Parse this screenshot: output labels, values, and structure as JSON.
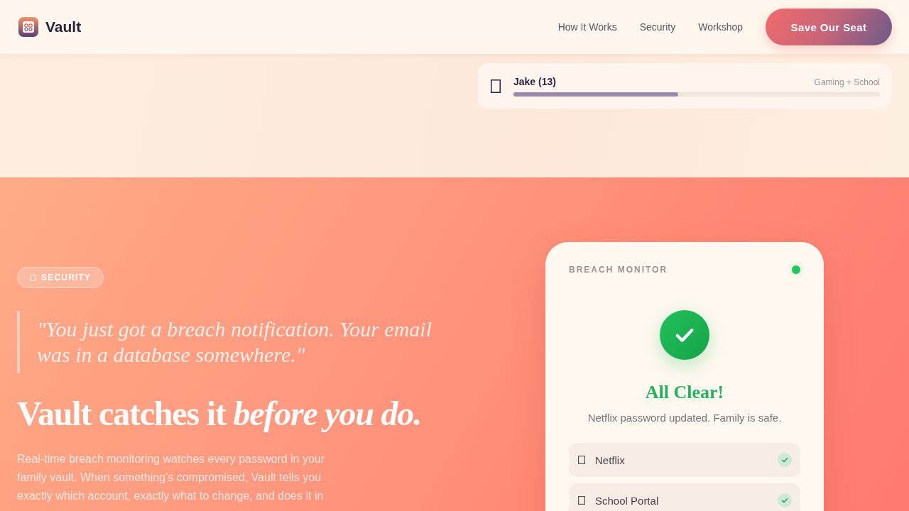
{
  "header": {
    "brand": "Vault",
    "nav": [
      {
        "label": "How It Works"
      },
      {
        "label": "Security"
      },
      {
        "label": "Workshop"
      }
    ],
    "cta": "Save Our Seat"
  },
  "family_card": {
    "name": "Jake (13)",
    "tag": "Gaming + School",
    "level": 0.45
  },
  "security": {
    "badge": "SECURITY",
    "quote": "\"You just got a breach notification. Your email was in a database somewhere.\"",
    "heading": "Vault catches it *before you do.*",
    "body": "Real-time breach monitoring watches every password in your family vault. When something’s compromised, Vault tells you exactly which account, exactly what to change, and does it in"
  },
  "monitor": {
    "title": "BREACH MONITOR",
    "status": "All Clear!",
    "message": "Netflix password updated. Family is safe.",
    "accounts": [
      {
        "name": "Netflix"
      },
      {
        "name": "School Portal"
      }
    ]
  }
}
